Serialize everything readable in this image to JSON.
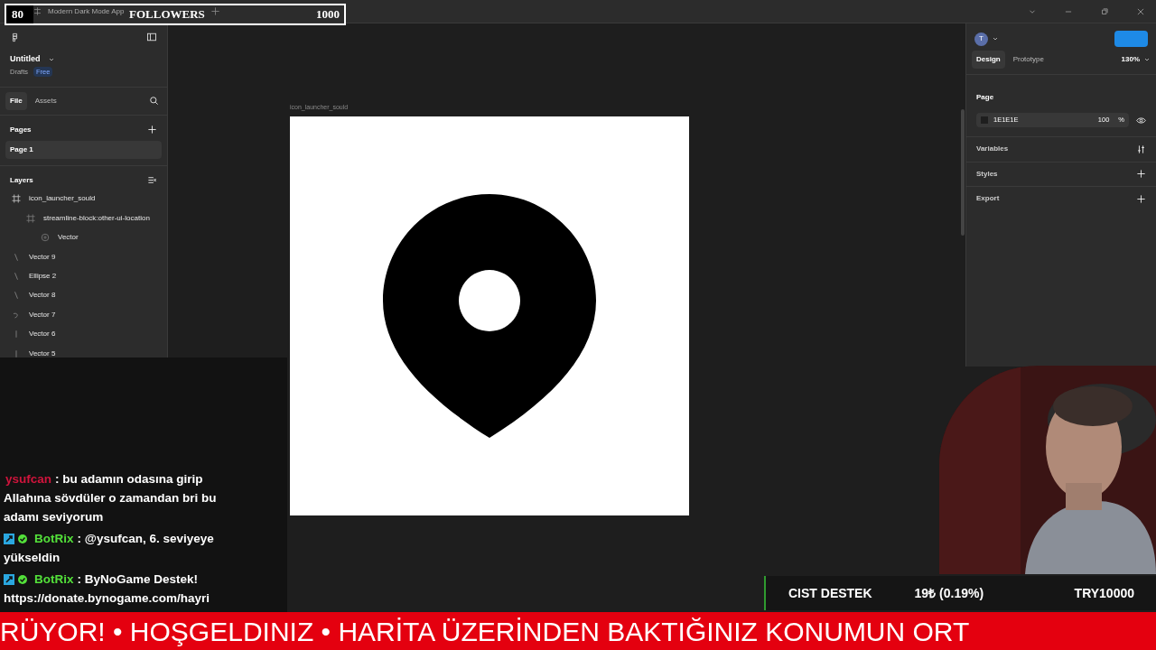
{
  "titlebar": {
    "tab_title": "Modern Dark Mode App"
  },
  "follower_goal": {
    "current": "80",
    "label": "FOLLOWERS",
    "target": "1000",
    "level": 0.08
  },
  "left_panel": {
    "file_name": "Untitled",
    "location": "Drafts",
    "plan_badge": "Free",
    "tabs": [
      {
        "label": "File",
        "selected": true
      },
      {
        "label": "Assets",
        "selected": false
      }
    ],
    "pages_title": "Pages",
    "pages": [
      {
        "label": "Page 1",
        "selected": true
      }
    ],
    "layers_title": "Layers",
    "layers": [
      {
        "name": "icon_launcher_sould",
        "kind": "frame",
        "children": [
          {
            "name": "streamline-block:other-ui-location",
            "kind": "frame-faint",
            "children": [
              {
                "name": "Vector",
                "kind": "target"
              }
            ]
          }
        ]
      },
      {
        "name": "Vector 9",
        "kind": "vector"
      },
      {
        "name": "Ellipse 2",
        "kind": "vector"
      },
      {
        "name": "Vector 8",
        "kind": "vector"
      },
      {
        "name": "Vector 7",
        "kind": "curve"
      },
      {
        "name": "Vector 6",
        "kind": "line"
      },
      {
        "name": "Vector 5",
        "kind": "line"
      }
    ]
  },
  "canvas": {
    "frame_label": "icon_launcher_sould"
  },
  "right_panel": {
    "avatar": "T",
    "tabs": [
      {
        "label": "Design",
        "selected": true
      },
      {
        "label": "Prototype",
        "selected": false
      }
    ],
    "zoom": "130%",
    "page_title": "Page",
    "fill_hex": "1E1E1E",
    "fill_opacity": "100",
    "percent": "%",
    "sections": [
      {
        "label": "Variables",
        "kind": "variables"
      },
      {
        "label": "Styles",
        "kind": "add"
      },
      {
        "label": "Export",
        "kind": "add"
      }
    ]
  },
  "chat": [
    {
      "kind": "user",
      "user": "ysufcan",
      "color": "#d0143c",
      "lines": [
        ": bu adamın odasına girip",
        "Allahına sövdüler o zamandan bri bu",
        "adamı seviyorum"
      ]
    },
    {
      "kind": "bot",
      "user": "BotRix",
      "color": "#53e03a",
      "lines": [
        ": @ysufcan, 6. seviyeye",
        "yükseldin"
      ]
    },
    {
      "kind": "bot",
      "user": "BotRix",
      "color": "#53e03a",
      "lines": [
        ": ByNoGame Destek!",
        "https://donate.bynogame.com/hayri"
      ]
    }
  ],
  "donation": {
    "name": "CIST DESTEK",
    "amount": "19₺ (0.19%)",
    "goal": "TRY10000"
  },
  "ticker": "RÜYOR! • HOŞGELDINIZ • HARİTA ÜZERİNDEN BAKTIĞINIZ KONUMUN ORT"
}
